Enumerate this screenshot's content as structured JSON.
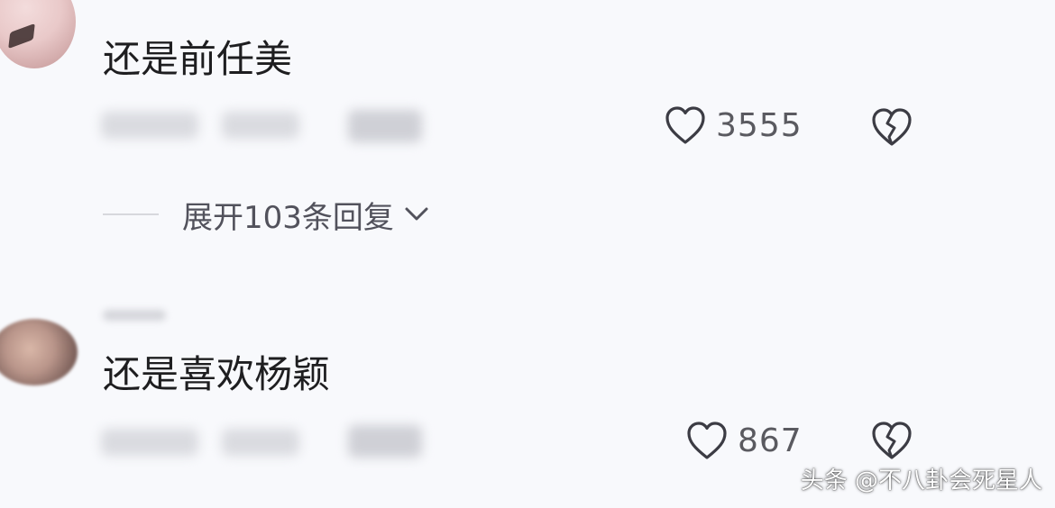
{
  "comments": [
    {
      "text": "还是前任美",
      "likes": "3555",
      "replies_label": "展开103条回复"
    },
    {
      "text": "还是喜欢杨颖",
      "likes": "867"
    }
  ],
  "watermark": "头条 @不八卦会死星人",
  "icons": {
    "like": "heart-outline-icon",
    "dislike": "broken-heart-icon",
    "expand": "chevron-down-icon"
  },
  "colors": {
    "background": "#f8f9fc",
    "text": "#1e1e20",
    "secondary": "#5a5a60"
  }
}
